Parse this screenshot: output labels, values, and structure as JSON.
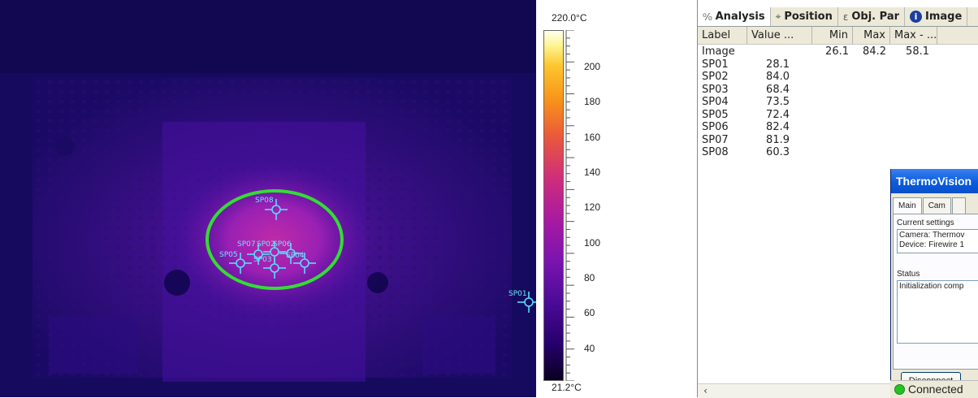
{
  "scale": {
    "max_label": "220.0°C",
    "min_label": "21.2°C",
    "ticks": [
      "200",
      "180",
      "160",
      "140",
      "120",
      "100",
      "80",
      "60",
      "40"
    ]
  },
  "spots": {
    "sp01": "SP01",
    "sp02": "SP02",
    "sp03": "SP03",
    "sp04": "SP04",
    "sp05": "SP05",
    "sp06": "SP06",
    "sp07": "SP07",
    "sp08": "SP08"
  },
  "tabs": [
    {
      "label": "Analysis",
      "icon": "analysis-icon"
    },
    {
      "label": "Position",
      "icon": "position-icon"
    },
    {
      "label": "Obj. Par",
      "icon": "object-parameters-icon"
    },
    {
      "label": "Image",
      "icon": "info-icon"
    }
  ],
  "table": {
    "headers": [
      "Label",
      "Value ...",
      "Min",
      "Max",
      "Max - ..."
    ],
    "rows": [
      [
        "Image",
        "",
        "26.1",
        "84.2",
        "58.1"
      ],
      [
        "SP01",
        "28.1",
        "",
        "",
        ""
      ],
      [
        "SP02",
        "84.0",
        "",
        "",
        ""
      ],
      [
        "SP03",
        "68.4",
        "",
        "",
        ""
      ],
      [
        "SP04",
        "73.5",
        "",
        "",
        ""
      ],
      [
        "SP05",
        "72.4",
        "",
        "",
        ""
      ],
      [
        "SP06",
        "82.4",
        "",
        "",
        ""
      ],
      [
        "SP07",
        "81.9",
        "",
        "",
        ""
      ],
      [
        "SP08",
        "60.3",
        "",
        "",
        ""
      ]
    ]
  },
  "dialog": {
    "title": "ThermoVision",
    "tabs": [
      "Main",
      "Cam",
      ""
    ],
    "current_settings_label": "Current settings",
    "settings_lines": [
      "Camera: Thermov",
      "Device: Firewire 1"
    ],
    "status_label": "Status",
    "status_text": "Initialization comp",
    "disconnect_label": "Disconnect",
    "connection_text": "Connected"
  },
  "colors": {
    "highlight_ellipse": "#33dd33",
    "spot_marker": "#55ddff",
    "connected": "#22c422"
  }
}
